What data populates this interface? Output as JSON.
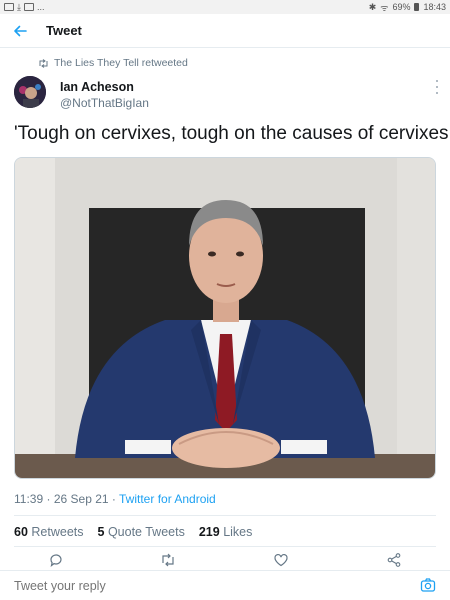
{
  "status_bar": {
    "left_icons": [
      "mail-icon",
      "download-icon",
      "image-icon",
      "more-dots-icon"
    ],
    "dots": "...",
    "battery": "69%",
    "time": "18:43"
  },
  "app_bar": {
    "title": "Tweet"
  },
  "retweet_context": {
    "text": "The Lies They Tell retweeted"
  },
  "author": {
    "name": "Ian Acheson",
    "handle": "@NotThatBigIan"
  },
  "tweet": {
    "text": "'Tough on cervixes, tough on the causes of cervixes.'",
    "time": "11:39",
    "date": "26 Sep 21",
    "separator": "·",
    "source": "Twitter for Android"
  },
  "stats": {
    "retweets_count": "60",
    "retweets_label": "Retweets",
    "quotes_count": "5",
    "quotes_label": "Quote Tweets",
    "likes_count": "219",
    "likes_label": "Likes"
  },
  "reply": {
    "placeholder": "Tweet your reply"
  },
  "colors": {
    "accent": "#1da1f2",
    "secondary_text": "#657786",
    "divider": "#e6ecf0"
  }
}
